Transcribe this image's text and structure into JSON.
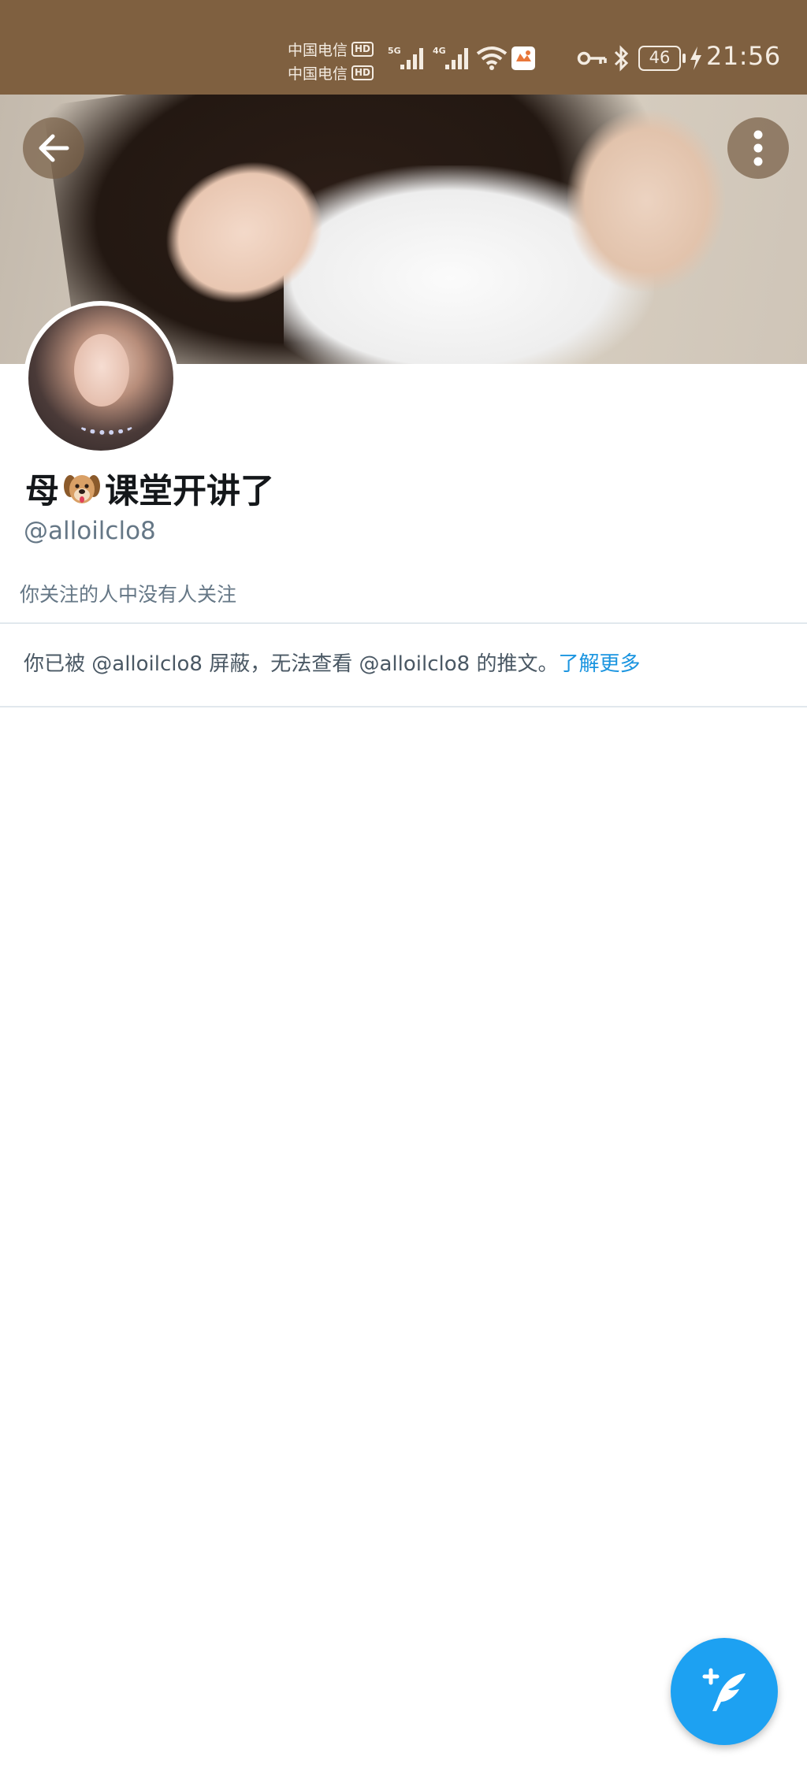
{
  "status_bar": {
    "carrier_1": "中国电信",
    "carrier_2": "中国电信",
    "hd_badge": "HD",
    "network_1": "5G",
    "network_2": "4G",
    "battery_level": "46",
    "time": "21:56",
    "icons": [
      "signal-icon",
      "signal-icon",
      "wifi-icon",
      "app-notification-icon",
      "key-icon",
      "bluetooth-icon",
      "battery-icon",
      "charging-icon"
    ]
  },
  "profile": {
    "display_name_before": "母",
    "display_name_emoji": "🐶",
    "display_name_after": "课堂开讲了",
    "handle": "@alloilclo8",
    "follow_status": "你关注的人中没有人关注"
  },
  "blocked_notice": {
    "text": "你已被 @alloilclo8 屏蔽，无法查看 @alloilclo8 的推文。",
    "learn_more": "了解更多"
  },
  "colors": {
    "status_bar_bg": "#7f6040",
    "accent": "#1da1f2",
    "link": "#1b95e0",
    "secondary_text": "#657786"
  }
}
